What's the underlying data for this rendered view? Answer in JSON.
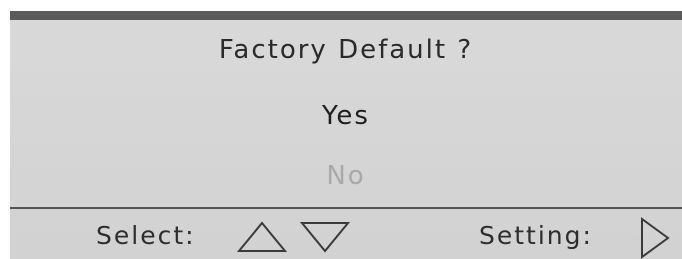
{
  "dialog": {
    "title": "Factory Default ?",
    "options": [
      "Yes",
      "No"
    ],
    "selected_option": "Yes"
  },
  "footer": {
    "select_label": "Select:",
    "setting_label": "Setting:"
  },
  "icons": {
    "up": "up-triangle-icon",
    "down": "down-triangle-icon",
    "right": "right-triangle-icon"
  },
  "colors": {
    "panel_background": "#d6d6d6",
    "top_bar": "#5a5a5a",
    "selected_text": "#1e1e1e",
    "unselected_text": "#a9a9a9"
  }
}
